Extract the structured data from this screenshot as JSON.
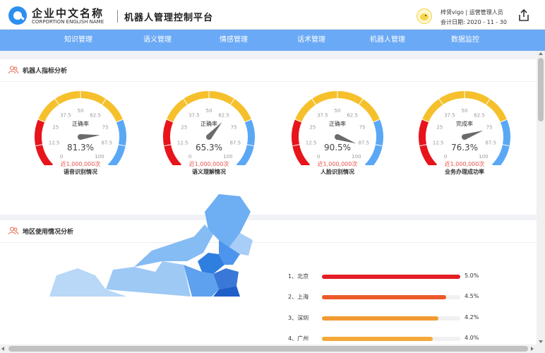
{
  "header": {
    "company_name": "企业中文名称",
    "company_en": "CORPORTION ENGLISH NAME",
    "app_title": "机器人管理控制平台",
    "user_text": "梓贤vigo | 运营管理人员",
    "date_label": "会计日期:",
    "date_value": "2020 - 11 - 30"
  },
  "nav": {
    "items": [
      "知识管理",
      "语义管理",
      "情感管理",
      "话术管理",
      "机器人管理",
      "数据监控"
    ]
  },
  "gauge_panel": {
    "title": "机器人指标分析",
    "ticks": [
      "0",
      "12.5",
      "25",
      "37.5",
      "50",
      "62.5",
      "75",
      "87.5",
      "100"
    ],
    "gauges": [
      {
        "label": "正确率",
        "value": 81.3,
        "display": "81.3%",
        "sub": "近1,000,000次",
        "name": "语音识别情况"
      },
      {
        "label": "正确率",
        "value": 65.3,
        "display": "65.3%",
        "sub": "近1,000,000次",
        "name": "语义理解情况"
      },
      {
        "label": "正确率",
        "value": 90.5,
        "display": "90.5%",
        "sub": "近1,000,000次",
        "name": "人脸识别情况"
      },
      {
        "label": "完成率",
        "value": 76.3,
        "display": "76.3%",
        "sub": "近1,000,000次",
        "name": "业务办理成功率"
      }
    ],
    "colors": {
      "low": "#e8141b",
      "mid": "#f5c02b",
      "high": "#5aa8f5"
    }
  },
  "region_panel": {
    "title": "地区使用情况分析",
    "ranking": [
      {
        "label": "1、北京",
        "value": 5.0,
        "display": "5.0%",
        "color": "#e31d23"
      },
      {
        "label": "2、上海",
        "value": 4.5,
        "display": "4.5%",
        "color": "#ec5a2a"
      },
      {
        "label": "3、深圳",
        "value": 4.2,
        "display": "4.2%",
        "color": "#f39a32"
      },
      {
        "label": "4、广州",
        "value": 4.0,
        "display": "4.0%",
        "color": "#f5a93a"
      }
    ]
  },
  "icons": {
    "export": "export-icon",
    "panel": "users-icon"
  }
}
